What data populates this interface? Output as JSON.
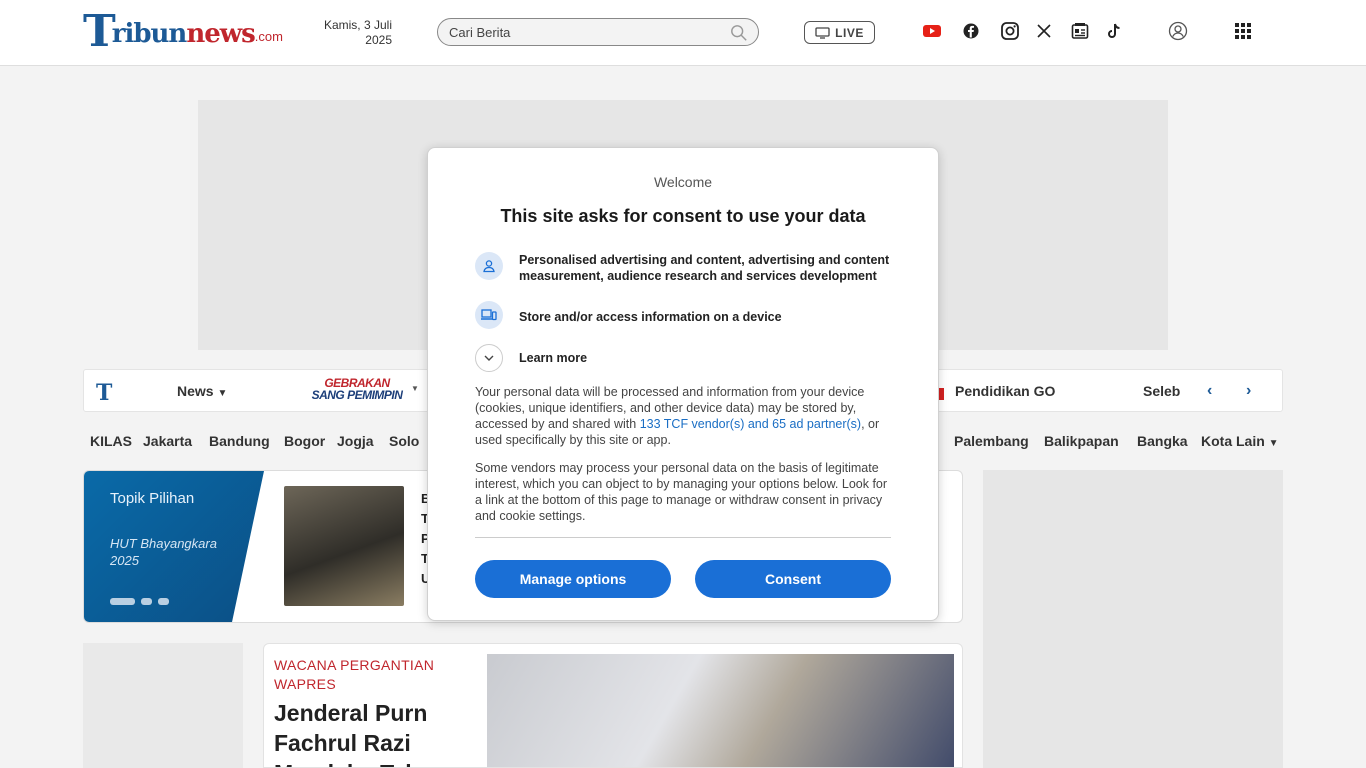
{
  "header": {
    "logo": {
      "t": "T",
      "ribun": "ribun",
      "news": "news",
      "com": ".com"
    },
    "date_line1": "Kamis, 3 Juli",
    "date_line2": "2025",
    "search_placeholder": "Cari Berita",
    "live_label": "LIVE",
    "social_icons": [
      "youtube-icon",
      "facebook-icon",
      "instagram-icon",
      "x-icon",
      "google-news-icon",
      "tiktok-icon"
    ],
    "colors": {
      "brand_blue": "#1d5a96",
      "brand_red": "#c0262d",
      "youtube_red": "#e62117"
    }
  },
  "nav": {
    "items": [
      "News",
      "Pendidikan GO",
      "Seleb"
    ],
    "gebrakan_line1": "GEBRAKAN",
    "gebrakan_line2": "SANG PEMIMPIN",
    "cities": [
      "KILAS",
      "Jakarta",
      "Bandung",
      "Bogor",
      "Jogja",
      "Solo",
      "Palembang",
      "Balikpapan",
      "Bangka",
      "Kota Lain"
    ]
  },
  "topik": {
    "title": "Topik Pilihan",
    "subtitle": "HUT Bhayangkara 2025",
    "snippet_letters": [
      "B",
      "T",
      "P",
      "T",
      "U"
    ]
  },
  "article": {
    "kicker": "WACANA PERGANTIAN WAPRES",
    "headline": "Jenderal Purn Fachrul Razi Mendaku Tak"
  },
  "consent": {
    "welcome": "Welcome",
    "title": "This site asks for consent to use your data",
    "purposes": [
      {
        "icon": "person-icon",
        "label": "Personalised advertising and content, advertising and content measurement, audience research and services development"
      },
      {
        "icon": "devices-icon",
        "label": "Store and/or access information on a device"
      }
    ],
    "learn_more": "Learn more",
    "para1_before": "Your personal data will be processed and information from your device (cookies, unique identifiers, and other device data) may be stored by, accessed by and shared with ",
    "para1_link": "133 TCF vendor(s) and 65 ad partner(s)",
    "para1_after": ", or used specifically by this site or app.",
    "para2": "Some vendors may process your personal data on the basis of legitimate interest, which you can object to by managing your options below. Look for a link at the bottom of this page to manage or withdraw consent in privacy and cookie settings.",
    "manage_button": "Manage options",
    "consent_button": "Consent",
    "colors": {
      "button": "#1a6fd6",
      "link": "#1a6ec4"
    }
  }
}
